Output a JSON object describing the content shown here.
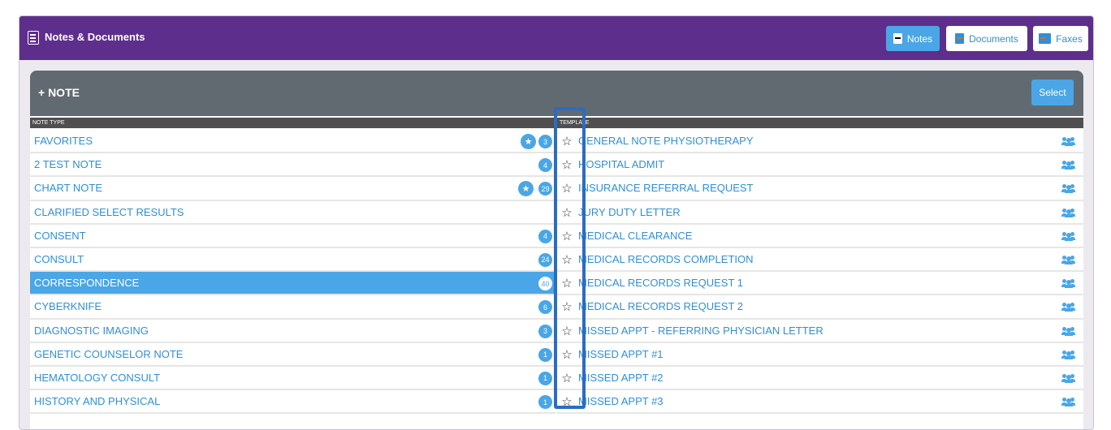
{
  "header": {
    "title": "Notes & Documents",
    "buttons": {
      "notes": "Notes",
      "documents": "Documents",
      "faxes": "Faxes"
    }
  },
  "section": {
    "add_note": "+ NOTE",
    "select_label": "Select",
    "col_note_type": "NOTE TYPE",
    "col_template": "TEMPLATE"
  },
  "note_types": [
    {
      "label": "FAVORITES",
      "count": "3",
      "fav": true
    },
    {
      "label": "2 TEST NOTE",
      "count": "4"
    },
    {
      "label": "CHART NOTE",
      "count": "29",
      "fav": true
    },
    {
      "label": "CLARIFIED SELECT RESULTS",
      "count": ""
    },
    {
      "label": "CONSENT",
      "count": "4"
    },
    {
      "label": "CONSULT",
      "count": "24"
    },
    {
      "label": "CORRESPONDENCE",
      "count": "40",
      "selected": true
    },
    {
      "label": "CYBERKNIFE",
      "count": "6"
    },
    {
      "label": "DIAGNOSTIC IMAGING",
      "count": "3"
    },
    {
      "label": "GENETIC COUNSELOR NOTE",
      "count": "1"
    },
    {
      "label": "HEMATOLOGY CONSULT",
      "count": "1"
    },
    {
      "label": "HISTORY AND PHYSICAL",
      "count": "1"
    }
  ],
  "templates": [
    {
      "label": "GENERAL NOTE PHYSIOTHERAPY"
    },
    {
      "label": "HOSPITAL ADMIT"
    },
    {
      "label": "INSURANCE REFERRAL REQUEST"
    },
    {
      "label": "JURY DUTY LETTER"
    },
    {
      "label": "MEDICAL CLEARANCE"
    },
    {
      "label": "MEDICAL RECORDS COMPLETION"
    },
    {
      "label": "MEDICAL RECORDS REQUEST 1"
    },
    {
      "label": "MEDICAL RECORDS REQUEST 2"
    },
    {
      "label": "MISSED APPT - REFERRING PHYSICIAN LETTER"
    },
    {
      "label": "MISSED APPT #1"
    },
    {
      "label": "MISSED APPT #2"
    },
    {
      "label": "MISSED APPT #3"
    }
  ],
  "icons": {
    "star": "star-outline-icon",
    "group": "group-icon",
    "favorite": "favorite-badge-icon"
  },
  "colors": {
    "header": "#5e2e8c",
    "accent": "#4aa6e6",
    "highlight": "#2b6cc4",
    "section_head": "#626a71"
  }
}
